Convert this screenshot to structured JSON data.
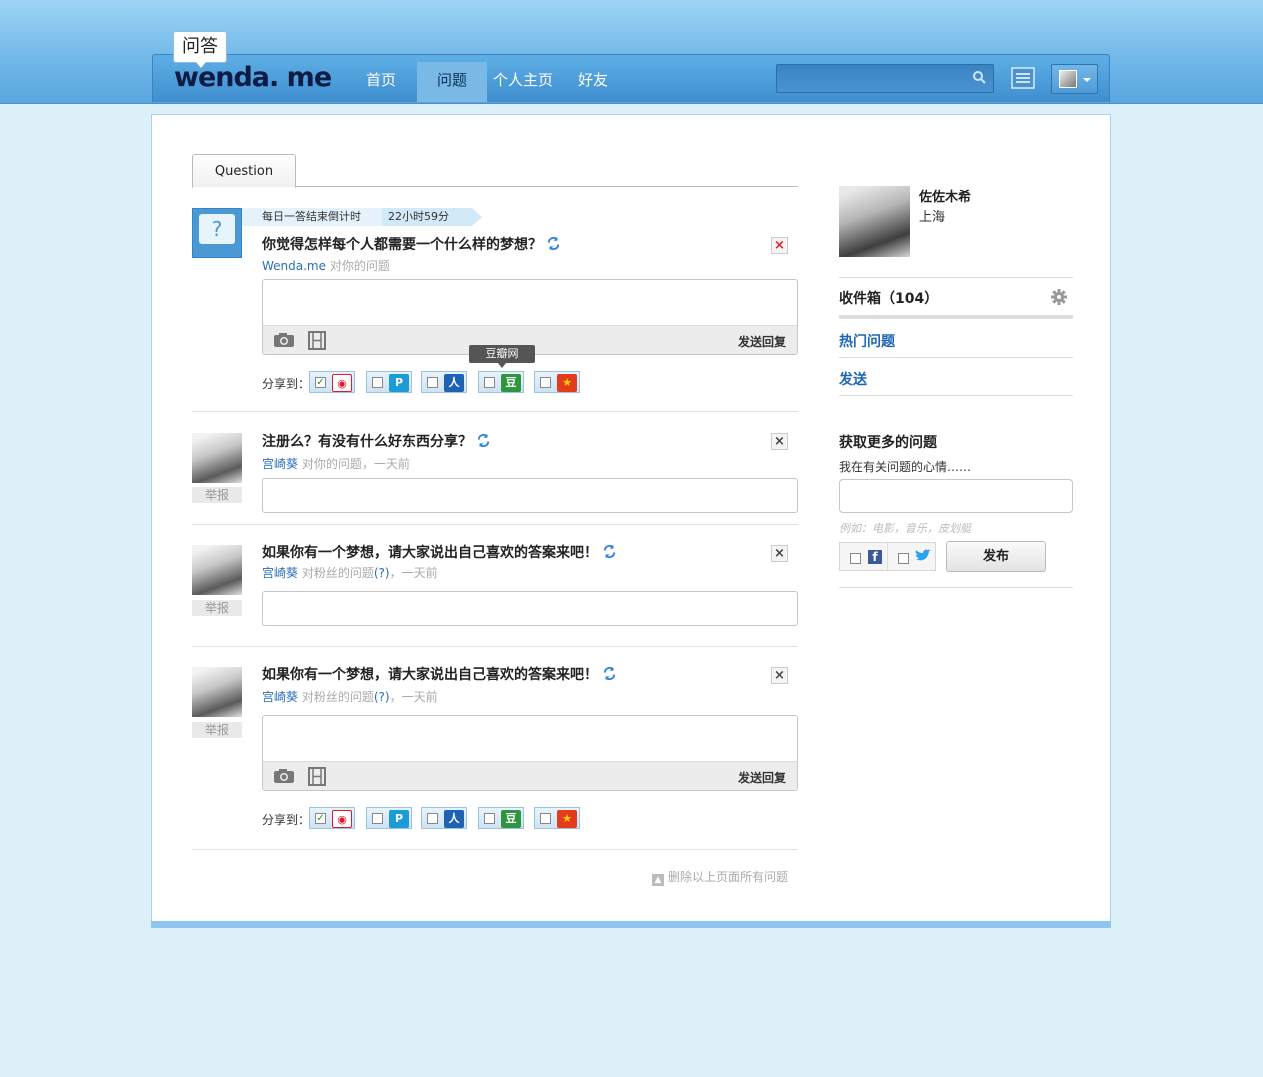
{
  "header": {
    "logo_badge": "问答",
    "logo_text": "wenda. me",
    "nav": [
      {
        "label": "首页",
        "active": false
      },
      {
        "label": "问题",
        "active": true
      },
      {
        "label": "个人主页",
        "active": false
      },
      {
        "label": "好友",
        "active": false
      }
    ],
    "search_value": ""
  },
  "tabs": [
    {
      "label": "Question"
    }
  ],
  "countdown": {
    "label": "每日一答结束倒计时",
    "time": "22小时59分"
  },
  "questions": [
    {
      "title": "你觉得怎样每个人都需要一个什么样的梦想？",
      "author": "Wenda.me",
      "meta": " 对你的问题",
      "reply_send": "发送回复",
      "share_label": "分享到：",
      "tooltip": "豆瓣网"
    },
    {
      "title": "注册么？有没有什么好东西分享？",
      "author": "宫崎葵",
      "meta": " 对你的问题，一天前",
      "report": "举报"
    },
    {
      "title": "如果你有一个梦想，请大家说出自己喜欢的答案来吧！",
      "author": "宫崎葵",
      "meta": " 对粉丝的问题",
      "meta_link": "(?)",
      "meta_tail": "，一天前",
      "report": "举报"
    },
    {
      "title": "如果你有一个梦想，请大家说出自己喜欢的答案来吧！",
      "author": "宫崎葵",
      "meta": " 对粉丝的问题",
      "meta_link": "(?)",
      "meta_tail": "，一天前",
      "report": "举报",
      "reply_send": "发送回复",
      "share_label": "分享到："
    }
  ],
  "share_services": [
    {
      "icon": "weibo-icon",
      "checked": true,
      "color": "#e6162d"
    },
    {
      "icon": "tencent-icon",
      "checked": false,
      "color": "#1b9bd7"
    },
    {
      "icon": "renren-icon",
      "checked": false,
      "color": "#1d62b4"
    },
    {
      "icon": "douban-icon",
      "checked": false,
      "color": "#2e963d"
    },
    {
      "icon": "kaixin-icon",
      "checked": false,
      "color": "#e33b1b"
    }
  ],
  "delete_all": "删除以上页面所有问题",
  "sidebar": {
    "profile_name": "佐佐木希",
    "profile_city": "上海",
    "inbox_label": "收件箱",
    "inbox_count": "（104）",
    "links": [
      "热门问题",
      "发送"
    ],
    "more_title": "获取更多的问题",
    "more_sub": "我在有关问题的心情……",
    "more_input_value": "",
    "more_hint": "例如：电影，音乐，皮划艇",
    "publish": "发布"
  }
}
